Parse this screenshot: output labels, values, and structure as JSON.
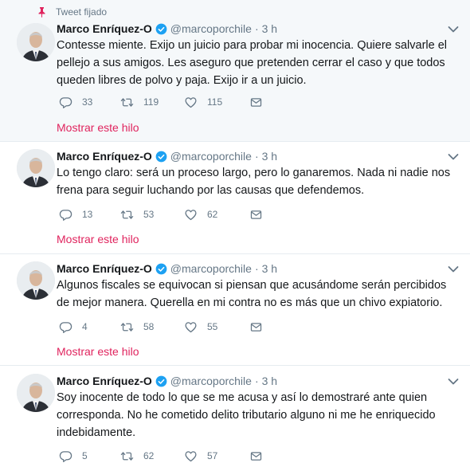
{
  "pinned_label": "Tweet fijado",
  "tweets": [
    {
      "name": "Marco Enríquez-O",
      "handle": "@marcoporchile",
      "separator": "·",
      "time": "3 h",
      "text": "Contesse miente. Exijo un juicio para probar mi inocencia. Quiere salvarle el pellejo a sus amigos. Les aseguro que pretenden cerrar el caso y que todos queden libres de polvo y paja. Exijo ir a un juicio.",
      "replies": "33",
      "retweets": "119",
      "likes": "115",
      "thread_link": "Mostrar este hilo"
    },
    {
      "name": "Marco Enríquez-O",
      "handle": "@marcoporchile",
      "separator": "·",
      "time": "3 h",
      "text": "Lo tengo claro: será un proceso largo, pero lo ganaremos. Nada ni nadie nos frena para seguir luchando por las causas que defendemos.",
      "replies": "13",
      "retweets": "53",
      "likes": "62",
      "thread_link": "Mostrar este hilo"
    },
    {
      "name": "Marco Enríquez-O",
      "handle": "@marcoporchile",
      "separator": "·",
      "time": "3 h",
      "text": "Algunos fiscales se equivocan si piensan que acusándome serán percibidos de mejor manera. Querella en mi contra no es más que un chivo expiatorio.",
      "replies": "4",
      "retweets": "58",
      "likes": "55",
      "thread_link": "Mostrar este hilo"
    },
    {
      "name": "Marco Enríquez-O",
      "handle": "@marcoporchile",
      "separator": "·",
      "time": "3 h",
      "text": "Soy inocente de todo lo que se me acusa y así lo demostraré ante quien corresponda. No he cometido delito tributario alguno ni me he enriquecido indebidamente.",
      "replies": "5",
      "retweets": "62",
      "likes": "57"
    }
  ],
  "colors": {
    "accent": "#1da1f2",
    "thread_link": "#e0245e",
    "pin": "#e0245e",
    "muted": "#657786",
    "pinned_background": "#f5f8fa"
  },
  "icons": [
    "pin-icon",
    "verified-badge-icon",
    "chevron-down-icon",
    "reply-icon",
    "retweet-icon",
    "like-icon",
    "direct-message-icon"
  ]
}
